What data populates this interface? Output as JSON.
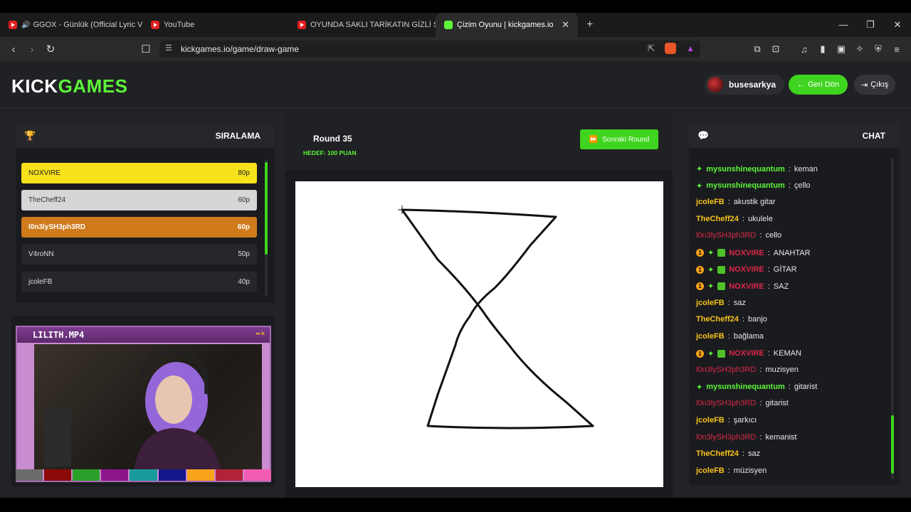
{
  "browser": {
    "tabs": [
      {
        "label": "GGOX - Günlük (Official Lyric Vid",
        "icon": "youtube-icon"
      },
      {
        "label": "YouTube",
        "icon": "youtube-icon"
      },
      {
        "label": "OYUNDA SAKLI TARİKATIN GİZLİ SIR",
        "icon": "youtube-icon"
      },
      {
        "label": "Çizim Oyunu | kickgames.io",
        "icon": "kickgames-icon"
      }
    ],
    "url": "kickgames.io/game/draw-game"
  },
  "header": {
    "logo_a": "KICK",
    "logo_b": "GAMES",
    "username": "busesarkya",
    "back_label": "Geri Dön",
    "exit_label": "Çıkış"
  },
  "ranking": {
    "title": "SIRALAMA",
    "items": [
      {
        "name": "NOXVIRE",
        "score": "80p",
        "color": "#f7e11b"
      },
      {
        "name": "TheCheff24",
        "score": "60p",
        "color": "#d6d6d6"
      },
      {
        "name": "l0n3lySH3ph3RD",
        "score": "60p",
        "color": "#d07a1c"
      },
      {
        "name": "V4roNN",
        "score": "50p",
        "color": "#26272b"
      },
      {
        "name": "jcoleFB",
        "score": "40p",
        "color": "#26272b"
      }
    ]
  },
  "round": {
    "label": "Round 35",
    "target": "HEDEF: 100 PUAN",
    "next_label": "Sonraki Round"
  },
  "video": {
    "title": "LILITH.MP4"
  },
  "palette": [
    "#6b6b6b",
    "#8b0a0a",
    "#2aa02a",
    "#8b158b",
    "#1a9b9b",
    "#14148b",
    "#f7a31b",
    "#b3233a",
    "#f25cb0"
  ],
  "chat": {
    "title": "CHAT",
    "messages": [
      {
        "user": "mysunshinequantum",
        "text": "keman",
        "style": "green",
        "badges": [
          "star"
        ]
      },
      {
        "user": "mysunshinequantum",
        "text": "çello",
        "style": "green",
        "badges": [
          "star"
        ]
      },
      {
        "user": "jcoleFB",
        "text": "akustik gitar",
        "style": "yellow",
        "badges": []
      },
      {
        "user": "TheCheff24",
        "text": "ukulele",
        "style": "yellow",
        "badges": []
      },
      {
        "user": "l0n3lySH3ph3RD",
        "text": "cello",
        "style": "red2",
        "badges": []
      },
      {
        "user": "NOXVIRE",
        "text": "ANAHTAR",
        "style": "red",
        "badges": [
          "one",
          "star",
          "gift"
        ]
      },
      {
        "user": "NOXVIRE",
        "text": "GİTAR",
        "style": "red",
        "badges": [
          "one",
          "star",
          "gift"
        ]
      },
      {
        "user": "NOXVIRE",
        "text": "SAZ",
        "style": "red",
        "badges": [
          "one",
          "star",
          "gift"
        ]
      },
      {
        "user": "jcoleFB",
        "text": "saz",
        "style": "yellow",
        "badges": []
      },
      {
        "user": "TheCheff24",
        "text": "banjo",
        "style": "yellow",
        "badges": []
      },
      {
        "user": "jcoleFB",
        "text": "bağlama",
        "style": "yellow",
        "badges": []
      },
      {
        "user": "NOXVIRE",
        "text": "KEMAN",
        "style": "red",
        "badges": [
          "one",
          "star",
          "gift"
        ]
      },
      {
        "user": "l0n3lySH3ph3RD",
        "text": "muzisyen",
        "style": "red2",
        "badges": []
      },
      {
        "user": "mysunshinequantum",
        "text": "gitarist",
        "style": "green",
        "badges": [
          "star"
        ]
      },
      {
        "user": "l0n3lySH3ph3RD",
        "text": "gitarist",
        "style": "red2",
        "badges": []
      },
      {
        "user": "jcoleFB",
        "text": "şarkıcı",
        "style": "yellow",
        "badges": []
      },
      {
        "user": "l0n3lySH3ph3RD",
        "text": "kemanist",
        "style": "red2",
        "badges": []
      },
      {
        "user": "TheCheff24",
        "text": "saz",
        "style": "yellow",
        "badges": []
      },
      {
        "user": "jcoleFB",
        "text": "müzisyen",
        "style": "yellow",
        "badges": []
      }
    ]
  }
}
